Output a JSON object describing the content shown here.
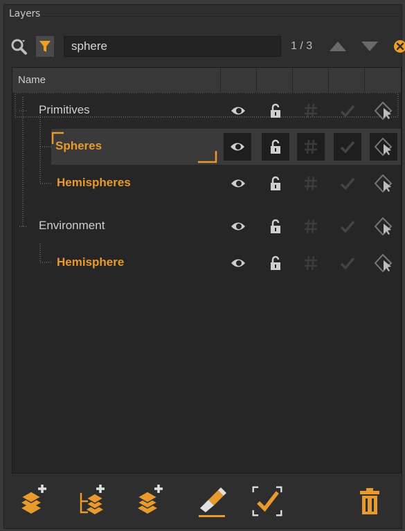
{
  "panel": {
    "title": "Layers"
  },
  "search": {
    "value": "sphere",
    "match_count": "1 / 3"
  },
  "tree": {
    "column_header": "Name",
    "rows": [
      {
        "label": "Primitives",
        "kind": "group"
      },
      {
        "label": "Spheres",
        "kind": "match",
        "selected": true
      },
      {
        "label": "Hemispheres",
        "kind": "match"
      },
      {
        "label": "Environment",
        "kind": "group"
      },
      {
        "label": "Hemisphere",
        "kind": "match"
      }
    ]
  },
  "toolbar": {
    "buttons": [
      "new-layer-icon",
      "new-sublayer-icon",
      "new-layer-from-selection-icon",
      "edit-layer-icon",
      "select-layer-objects-icon",
      "delete-layer-icon"
    ]
  },
  "colors": {
    "accent": "#e99a2c",
    "panel_bg": "#2e2e2e",
    "tree_bg": "#262626"
  }
}
